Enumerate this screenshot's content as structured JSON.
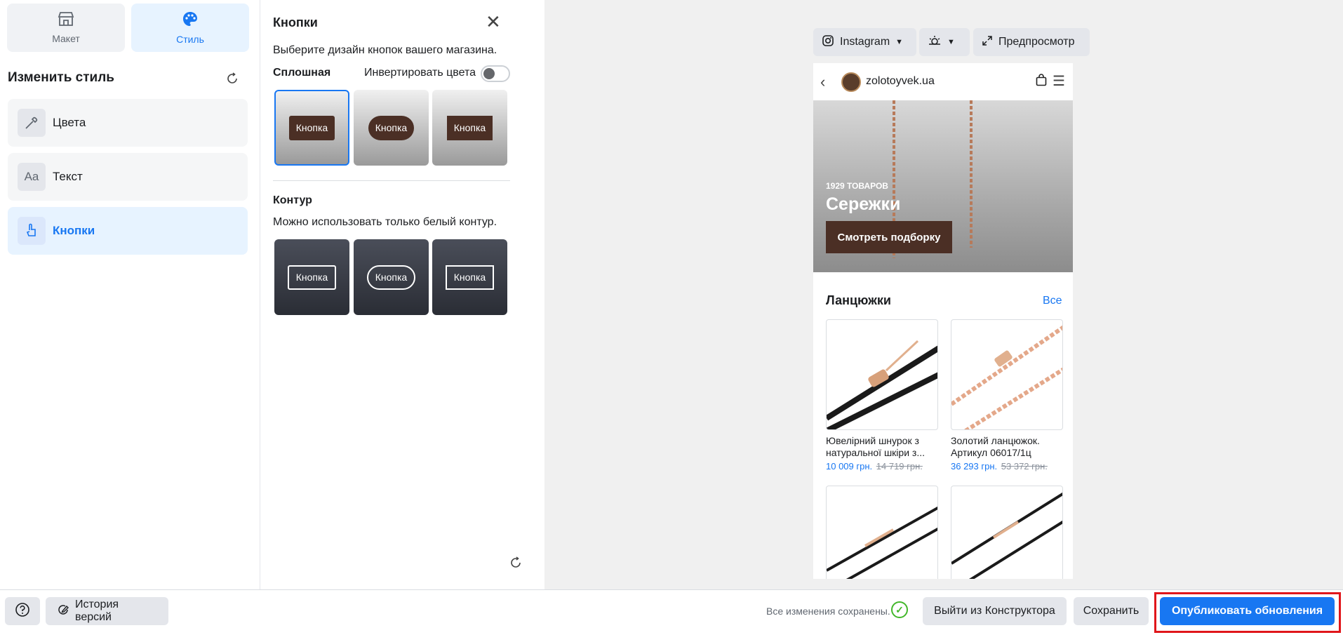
{
  "sidebar": {
    "tabs": [
      {
        "label": "Макет",
        "icon": "storefront-icon"
      },
      {
        "label": "Стиль",
        "icon": "palette-icon"
      }
    ],
    "heading": "Изменить стиль",
    "items": [
      {
        "label": "Цвета",
        "icon": "eyedropper-icon"
      },
      {
        "label": "Текст",
        "icon": "text-aa-icon"
      },
      {
        "label": "Кнопки",
        "icon": "tap-hand-icon",
        "active": true
      }
    ]
  },
  "panel": {
    "title": "Кнопки",
    "description": "Выберите дизайн кнопок вашего магазина.",
    "solid_label": "Сплошная",
    "invert_label": "Инвертировать цвета",
    "invert_on": false,
    "solid_options": [
      "Кнопка",
      "Кнопка",
      "Кнопка"
    ],
    "outline_label": "Контур",
    "outline_description": "Можно использовать только белый контур.",
    "outline_options": [
      "Кнопка",
      "Кнопка",
      "Кнопка"
    ]
  },
  "preview": {
    "channel": "Instagram",
    "preview_label": "Предпросмотр",
    "store_name": "zolotoyvek.ua",
    "hero": {
      "count": "1929 ТОВАРОВ",
      "title": "Сережки",
      "cta": "Смотреть подборку"
    },
    "collection": {
      "title": "Ланцюжки",
      "all_label": "Все",
      "products": [
        {
          "name": "Ювелірний шнурок з натуральної шкіри з...",
          "price": "10 009 грн.",
          "old_price": "14 719 грн."
        },
        {
          "name": "Золотий ланцюжок. Артикул 06017/1ц",
          "price": "36 293 грн.",
          "old_price": "53 372 грн."
        }
      ]
    }
  },
  "footer": {
    "help_icon": "question-icon",
    "history_label": "История версий",
    "saved_text": "Все изменения сохранены.",
    "exit_label": "Выйти из Конструктора",
    "save_label": "Сохранить",
    "publish_label": "Опубликовать обновления"
  },
  "colors": {
    "accent": "#1877f2",
    "button_brown": "#4b2f25",
    "highlight_frame": "#e0161b"
  }
}
